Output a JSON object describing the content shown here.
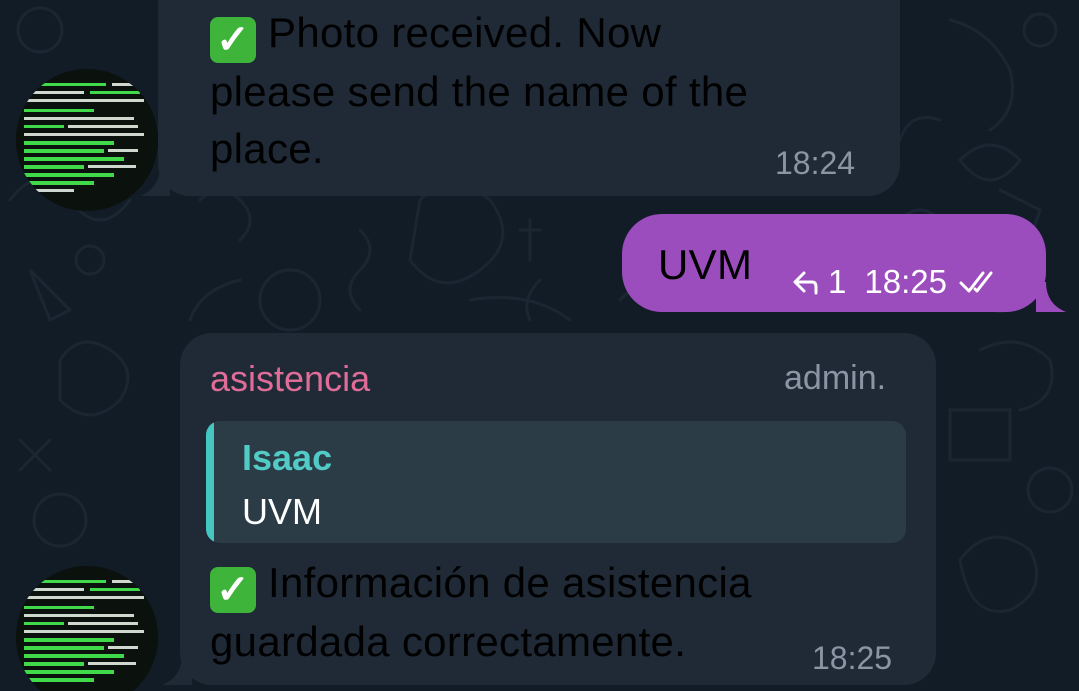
{
  "messages": {
    "first": {
      "prefix_icon": "white-check-mark-emoji",
      "line1": "Photo received. Now",
      "line2": "please send the name of the",
      "line3": "place.",
      "time": "18:24"
    },
    "outgoing": {
      "text": "UVM",
      "reply_count": "1",
      "time": "18:25",
      "status_icon": "double-check-icon"
    },
    "third": {
      "sender": "asistencia",
      "sender_role": "admin.",
      "quote": {
        "name": "Isaac",
        "text": "UVM"
      },
      "prefix_icon": "white-check-mark-emoji",
      "line1": "Información de asistencia",
      "line2": "guardada correctamente.",
      "time": "18:25"
    }
  },
  "colors": {
    "background": "#111c27",
    "incoming_bubble": "#1f2a36",
    "outgoing_bubble": "#9b4cbd",
    "sender_name": "#e06c98",
    "quote_accent": "#45c6c0",
    "timestamp": "#8a96a3",
    "check_emoji": "#3fb43a"
  }
}
